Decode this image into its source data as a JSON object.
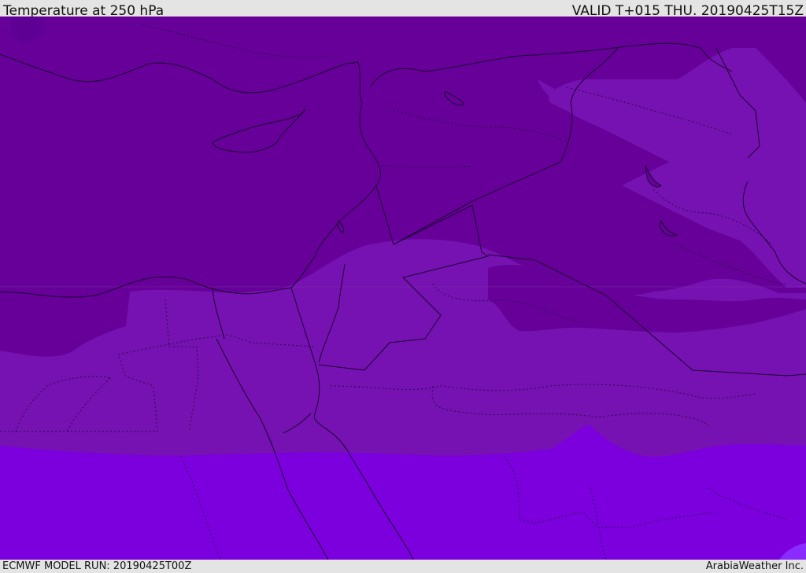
{
  "header": {
    "title": "Temperature at 250 hPa",
    "valid_time": "VALID T+015 THU. 20190425T15Z"
  },
  "footer": {
    "model_run": "ECMWF MODEL RUN: 20190425T00Z",
    "brand": "ArabiaWeather Inc."
  },
  "map": {
    "field": "Temperature at 250 hPa",
    "colors": {
      "coldest_band": "#5e0094",
      "cold_band": "#660099",
      "mid_band": "#7612b2",
      "warm_band": "#7b00dd",
      "warmest_patch": "#8a2cff",
      "coastline": "#1a0030",
      "borders": "#1a0030"
    }
  }
}
